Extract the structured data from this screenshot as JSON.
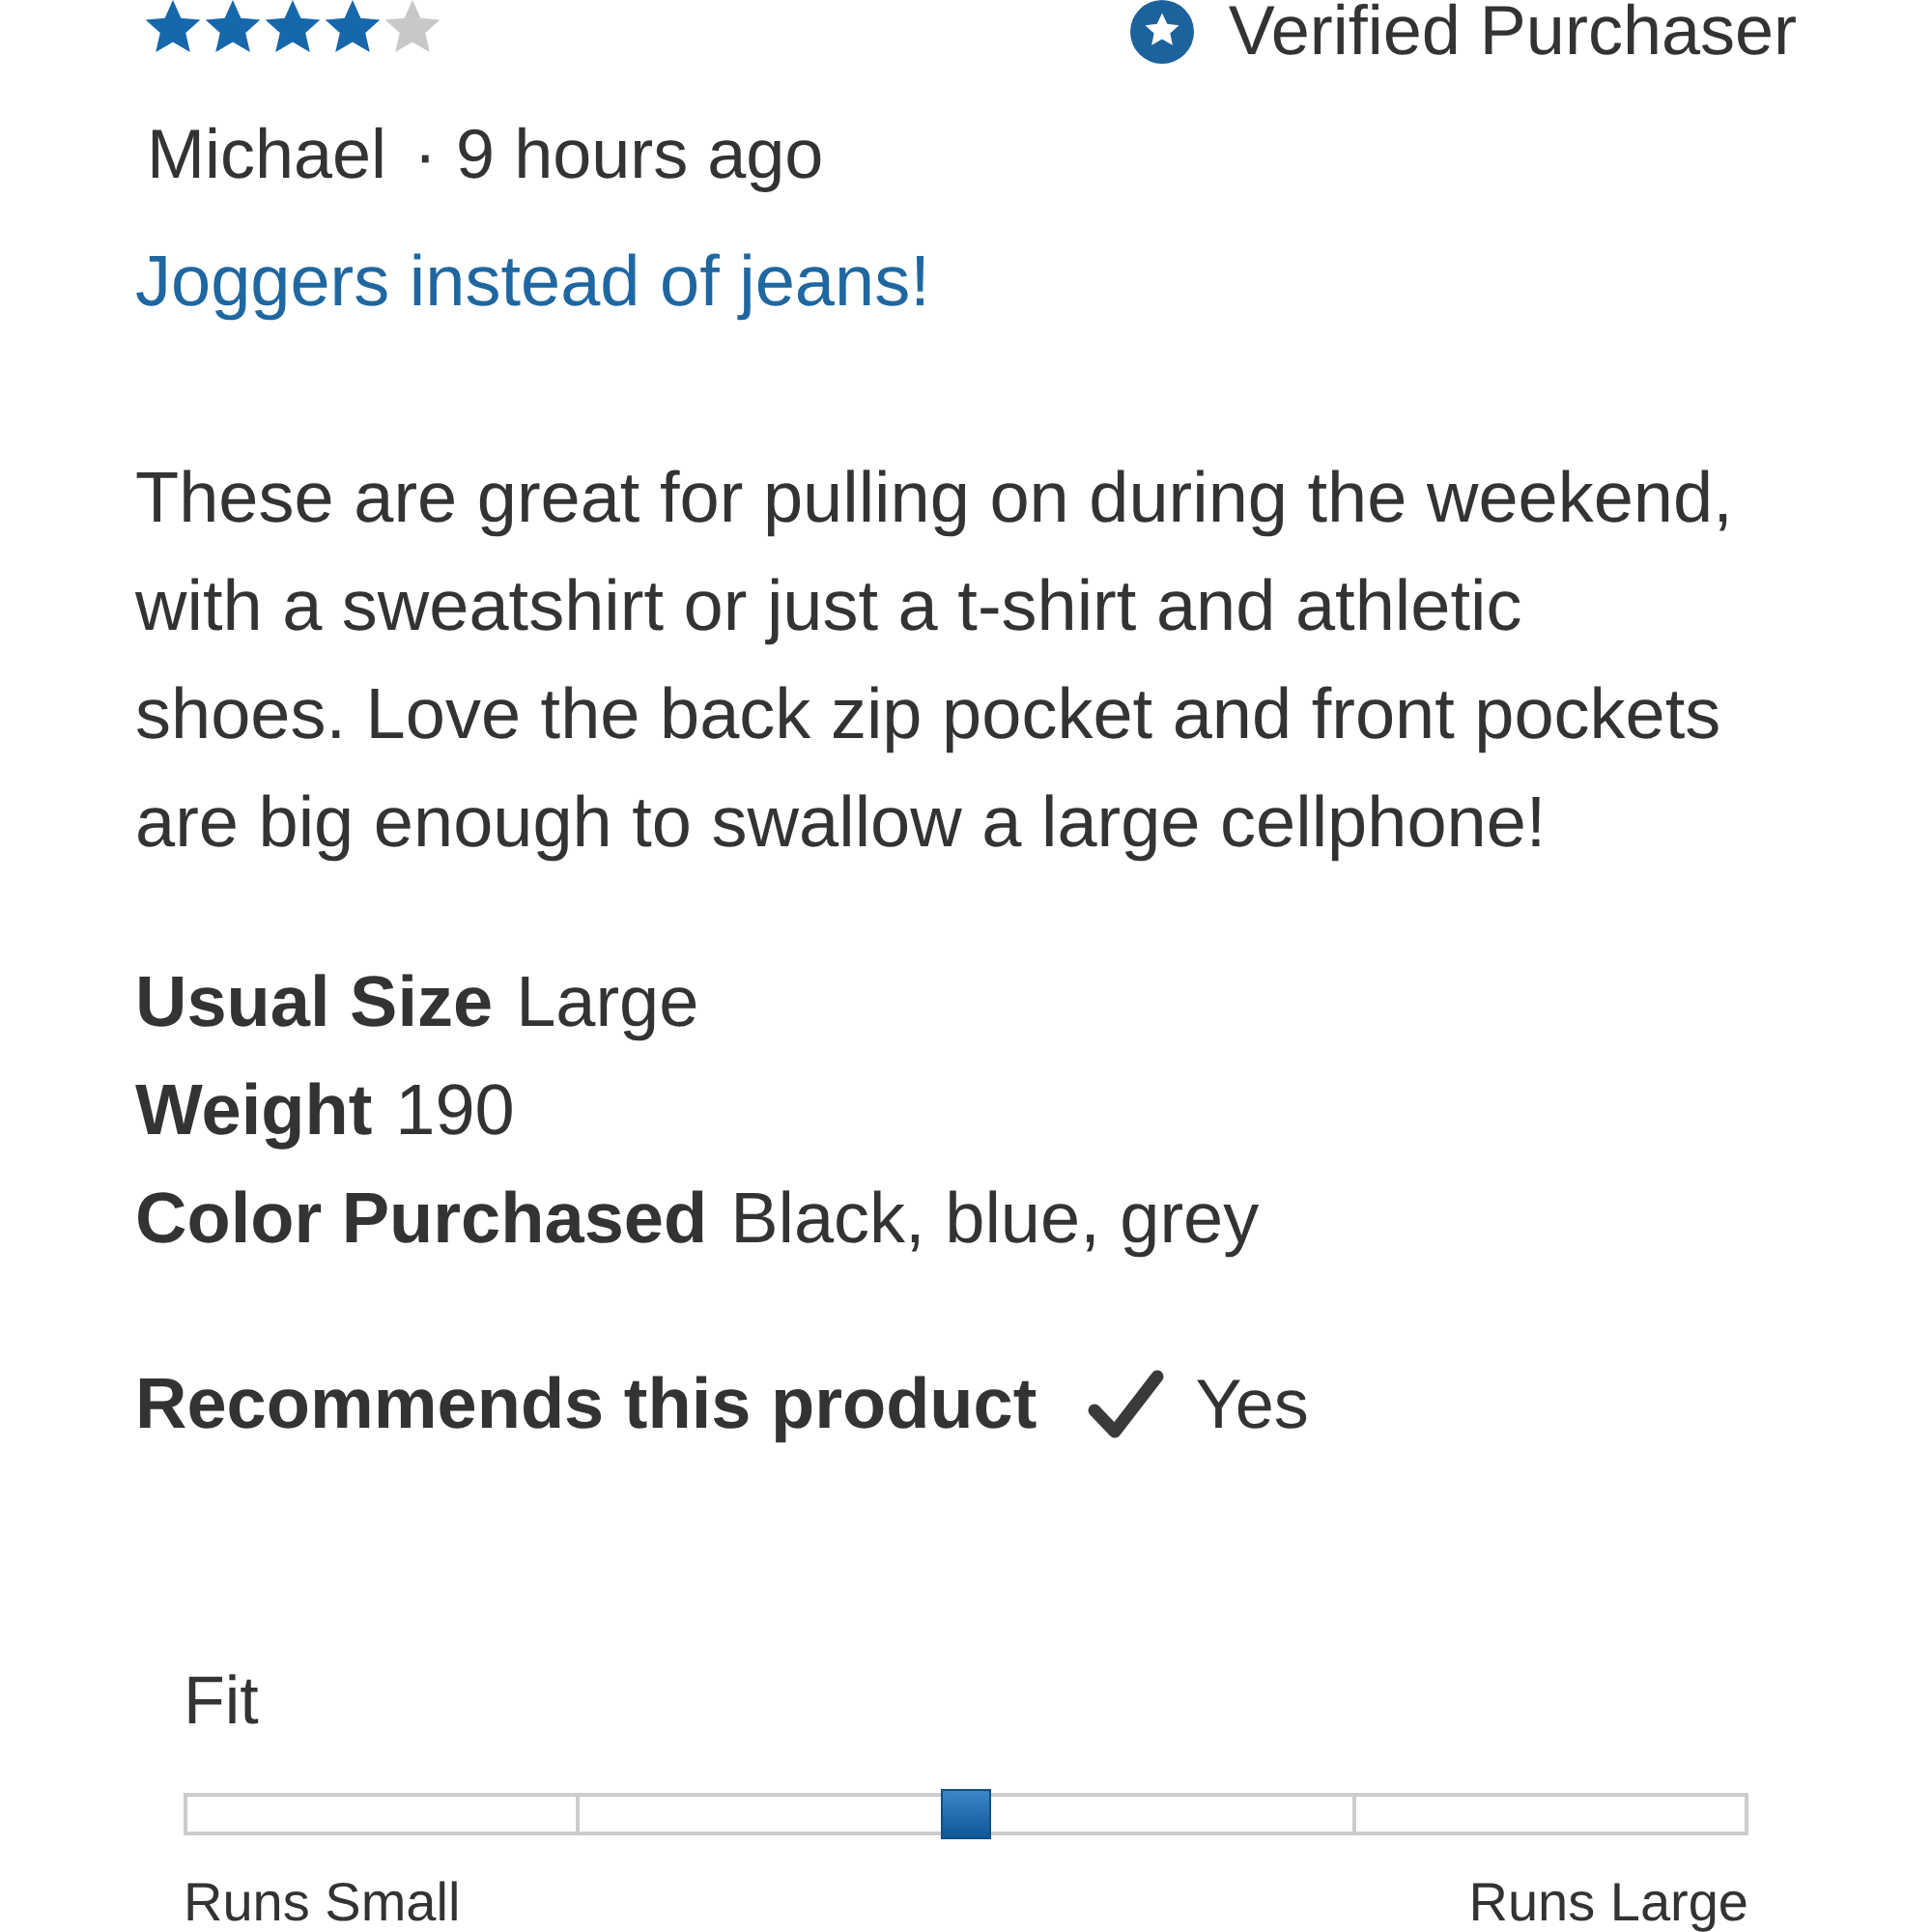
{
  "review": {
    "stars": 4,
    "verified_badge": {
      "label": "Verified Purchaser"
    },
    "author": "Michael",
    "posted": "· 9 hours ago",
    "title": "Joggers instead of jeans!",
    "body": "These are great for pulling on during the weekend,\nwith a sweatshirt or just a t-shirt and athletic\nshoes. Love the back zip pocket and front pockets\nare big enough to swallow a large cellphone!",
    "details": [
      {
        "label": "Usual Size",
        "value": "Large"
      },
      {
        "label": "Weight",
        "value": "190"
      },
      {
        "label": "Color Purchased",
        "value": "Black, blue, grey"
      }
    ],
    "recommendation": {
      "label": "Recommends this product",
      "recommended": true,
      "answer": "Yes"
    }
  },
  "fit": {
    "label": "Fit",
    "level": 0.5,
    "min_label": "Runs Small",
    "max_label": "Runs Large"
  }
}
